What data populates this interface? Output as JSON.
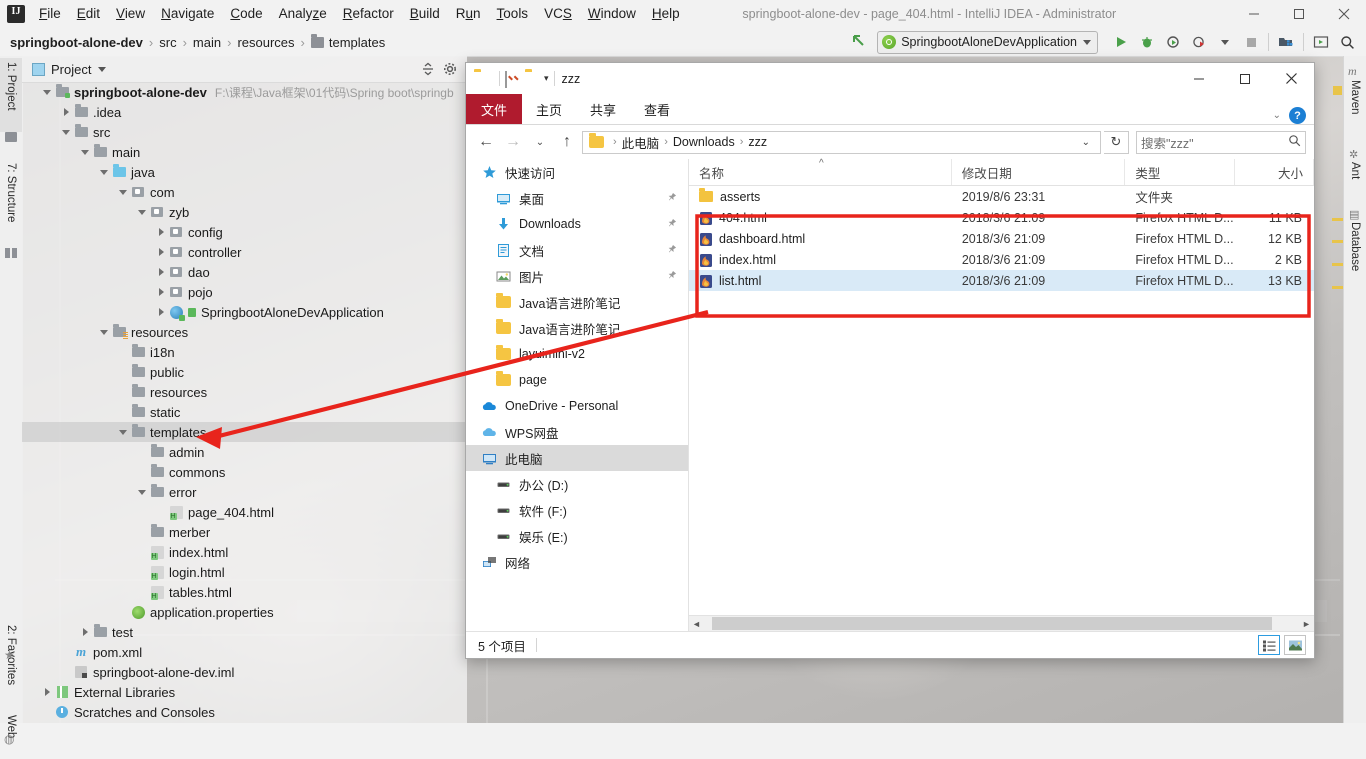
{
  "window": {
    "title": "springboot-alone-dev - page_404.html - IntelliJ IDEA - Administrator",
    "minimize": "—",
    "maximize": "❐",
    "close": "✕"
  },
  "menubar": {
    "items": [
      "File",
      "Edit",
      "View",
      "Navigate",
      "Code",
      "Analyze",
      "Refactor",
      "Build",
      "Run",
      "Tools",
      "VCS",
      "Window",
      "Help"
    ]
  },
  "breadcrumb": {
    "items": [
      {
        "label": "springboot-alone-dev",
        "bold": true,
        "icon": ""
      },
      {
        "label": "src",
        "bold": false,
        "icon": ""
      },
      {
        "label": "main",
        "bold": false,
        "icon": ""
      },
      {
        "label": "resources",
        "bold": false,
        "icon": ""
      },
      {
        "label": "templates",
        "bold": false,
        "icon": "folder-icon"
      }
    ],
    "separator": "›"
  },
  "toolbar": {
    "run_config": "SpringbootAloneDevApplication",
    "icons": [
      "back-arrow-icon",
      "run-icon",
      "debug-icon",
      "run-coverage-icon",
      "profile-icon",
      "stop-icon",
      "build-project-icon",
      "show-in-browser-icon",
      "search-everywhere-icon"
    ]
  },
  "left_tool_strip": {
    "tabs_top": [
      "1: Project",
      "7: Structure"
    ],
    "tabs_bottom": [
      "2: Favorites",
      "Web"
    ]
  },
  "right_tool_strip": {
    "tabs": [
      "Maven",
      "Ant",
      "Database"
    ]
  },
  "project_panel": {
    "header_label": "Project",
    "header_icons": [
      "collapse-all-icon",
      "settings-gear-icon"
    ],
    "tree": [
      {
        "depth": 0,
        "twisty": "expanded",
        "icon": "module-folder-icon",
        "label": "springboot-alone-dev",
        "bold": true,
        "path": "F:\\课程\\Java框架\\01代码\\Spring boot\\springb"
      },
      {
        "depth": 1,
        "twisty": "collapsed",
        "icon": "folder-icon",
        "label": ".idea"
      },
      {
        "depth": 1,
        "twisty": "expanded",
        "icon": "folder-icon",
        "label": "src"
      },
      {
        "depth": 2,
        "twisty": "expanded",
        "icon": "folder-icon",
        "label": "main"
      },
      {
        "depth": 3,
        "twisty": "expanded",
        "icon": "source-folder-icon",
        "label": "java"
      },
      {
        "depth": 4,
        "twisty": "expanded",
        "icon": "package-icon",
        "label": "com"
      },
      {
        "depth": 5,
        "twisty": "expanded",
        "icon": "package-icon",
        "label": "zyb"
      },
      {
        "depth": 6,
        "twisty": "collapsed",
        "icon": "package-icon",
        "label": "config"
      },
      {
        "depth": 6,
        "twisty": "collapsed",
        "icon": "package-icon",
        "label": "controller"
      },
      {
        "depth": 6,
        "twisty": "collapsed",
        "icon": "package-icon",
        "label": "dao"
      },
      {
        "depth": 6,
        "twisty": "collapsed",
        "icon": "package-icon",
        "label": "pojo"
      },
      {
        "depth": 6,
        "twisty": "collapsed",
        "icon": "java-class-icon",
        "label": "SpringbootAloneDevApplication"
      },
      {
        "depth": 3,
        "twisty": "expanded",
        "icon": "resources-folder-icon",
        "label": "resources"
      },
      {
        "depth": 4,
        "twisty": "none",
        "icon": "folder-icon",
        "label": "i18n"
      },
      {
        "depth": 4,
        "twisty": "none",
        "icon": "folder-icon",
        "label": "public"
      },
      {
        "depth": 4,
        "twisty": "none",
        "icon": "folder-icon",
        "label": "resources"
      },
      {
        "depth": 4,
        "twisty": "none",
        "icon": "folder-icon",
        "label": "static"
      },
      {
        "depth": 4,
        "twisty": "expanded",
        "icon": "folder-icon",
        "label": "templates",
        "selected": true
      },
      {
        "depth": 5,
        "twisty": "none",
        "icon": "folder-icon",
        "label": "admin"
      },
      {
        "depth": 5,
        "twisty": "none",
        "icon": "folder-icon",
        "label": "commons"
      },
      {
        "depth": 5,
        "twisty": "expanded",
        "icon": "folder-icon",
        "label": "error"
      },
      {
        "depth": 6,
        "twisty": "none",
        "icon": "html-file-icon",
        "label": "page_404.html"
      },
      {
        "depth": 5,
        "twisty": "none",
        "icon": "folder-icon",
        "label": "merber"
      },
      {
        "depth": 5,
        "twisty": "none",
        "icon": "html-file-icon",
        "label": "index.html"
      },
      {
        "depth": 5,
        "twisty": "none",
        "icon": "html-file-icon",
        "label": "login.html"
      },
      {
        "depth": 5,
        "twisty": "none",
        "icon": "html-file-icon",
        "label": "tables.html"
      },
      {
        "depth": 4,
        "twisty": "none",
        "icon": "properties-file-icon",
        "label": "application.properties"
      },
      {
        "depth": 2,
        "twisty": "collapsed",
        "icon": "folder-icon",
        "label": "test"
      },
      {
        "depth": 1,
        "twisty": "none",
        "icon": "maven-pom-icon",
        "label": "pom.xml"
      },
      {
        "depth": 1,
        "twisty": "none",
        "icon": "iml-file-icon",
        "label": "springboot-alone-dev.iml"
      },
      {
        "depth": 0,
        "twisty": "collapsed",
        "icon": "library-icon",
        "label": "External Libraries"
      },
      {
        "depth": 0,
        "twisty": "none",
        "icon": "scratches-icon",
        "label": "Scratches and Consoles"
      }
    ]
  },
  "explorer": {
    "title": "zzz",
    "quick_access_icons": [
      "folder-icon",
      "properties-icon",
      "new-folder-dropdown-icon"
    ],
    "window_buttons": {
      "minimize": "—",
      "maximize": "❐",
      "close": "✕"
    },
    "ribbon": {
      "file_tab": "文件",
      "tabs": [
        "主页",
        "共享",
        "查看"
      ],
      "collapse_icon": "chevron-down-icon",
      "help_icon": "?"
    },
    "address": {
      "back": "←",
      "forward": "→",
      "recent": "⌄",
      "up": "↑",
      "crumbs": [
        "此电脑",
        "Downloads",
        "zzz"
      ],
      "separator": "›",
      "dropdown": "⌄",
      "refresh": "↻",
      "search_placeholder": "搜索\"zzz\""
    },
    "nav_pane": [
      {
        "label": "快速访问",
        "icon": "quick-access-star-icon",
        "pinned": false,
        "indent": 0
      },
      {
        "label": "桌面",
        "icon": "desktop-icon",
        "pinned": true,
        "indent": 1
      },
      {
        "label": "Downloads",
        "icon": "downloads-icon",
        "pinned": true,
        "indent": 1
      },
      {
        "label": "文档",
        "icon": "documents-icon",
        "pinned": true,
        "indent": 1
      },
      {
        "label": "图片",
        "icon": "pictures-icon",
        "pinned": true,
        "indent": 1
      },
      {
        "label": "Java语言进阶笔记",
        "icon": "folder-icon",
        "pinned": false,
        "indent": 1
      },
      {
        "label": "Java语言进阶笔记",
        "icon": "folder-icon",
        "pinned": false,
        "indent": 1
      },
      {
        "label": "layuimini-v2",
        "icon": "folder-icon",
        "pinned": false,
        "indent": 1
      },
      {
        "label": "page",
        "icon": "folder-icon",
        "pinned": false,
        "indent": 1
      },
      {
        "label": "OneDrive - Personal",
        "icon": "onedrive-icon",
        "pinned": false,
        "indent": 0
      },
      {
        "label": "WPS网盘",
        "icon": "wps-cloud-icon",
        "pinned": false,
        "indent": 0
      },
      {
        "label": "此电脑",
        "icon": "this-pc-icon",
        "pinned": false,
        "indent": 0,
        "selected": true
      },
      {
        "label": "办公 (D:)",
        "icon": "drive-icon",
        "pinned": false,
        "indent": 1
      },
      {
        "label": "软件 (F:)",
        "icon": "drive-icon",
        "pinned": false,
        "indent": 1
      },
      {
        "label": "娱乐 (E:)",
        "icon": "drive-icon",
        "pinned": false,
        "indent": 1
      },
      {
        "label": "网络",
        "icon": "network-icon",
        "pinned": false,
        "indent": 0
      }
    ],
    "columns": [
      "名称",
      "修改日期",
      "类型",
      "大小"
    ],
    "files": [
      {
        "name": "asserts",
        "date": "2019/8/6 23:31",
        "type": "文件夹",
        "size": "",
        "icon": "folder-icon",
        "selected": false
      },
      {
        "name": "404.html",
        "date": "2018/3/6 21:09",
        "type": "Firefox HTML D...",
        "size": "11 KB",
        "icon": "firefox-html-icon",
        "selected": false
      },
      {
        "name": "dashboard.html",
        "date": "2018/3/6 21:09",
        "type": "Firefox HTML D...",
        "size": "12 KB",
        "icon": "firefox-html-icon",
        "selected": false
      },
      {
        "name": "index.html",
        "date": "2018/3/6 21:09",
        "type": "Firefox HTML D...",
        "size": "2 KB",
        "icon": "firefox-html-icon",
        "selected": false
      },
      {
        "name": "list.html",
        "date": "2018/3/6 21:09",
        "type": "Firefox HTML D...",
        "size": "13 KB",
        "icon": "firefox-html-icon",
        "selected": true
      }
    ],
    "status": {
      "item_count": "5 个项目",
      "view_buttons": [
        "details-view-icon",
        "large-icons-view-icon"
      ]
    }
  },
  "annotations": {
    "highlight_color": "#e8241c",
    "arrow": "red-arrow-pointing-to-templates-folder",
    "box": "red-box-around-html-files"
  }
}
